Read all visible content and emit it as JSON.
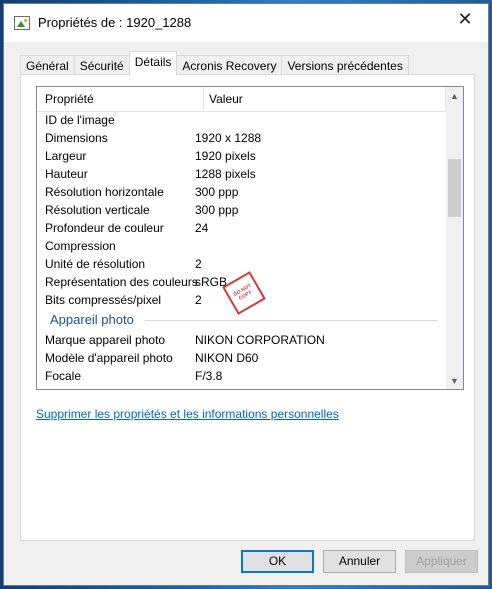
{
  "window": {
    "title": "Propriétés de : 1920_1288",
    "close_glyph": "✕"
  },
  "tabs": [
    {
      "label": "Général"
    },
    {
      "label": "Sécurité"
    },
    {
      "label": "Détails",
      "active": true
    },
    {
      "label": "Acronis Recovery"
    },
    {
      "label": "Versions précédentes"
    }
  ],
  "list": {
    "header_property": "Propriété",
    "header_value": "Valeur",
    "rows": [
      {
        "k": "ID de l'image",
        "v": ""
      },
      {
        "k": "Dimensions",
        "v": "1920 x 1288"
      },
      {
        "k": "Largeur",
        "v": "1920 pixels"
      },
      {
        "k": "Hauteur",
        "v": "1288 pixels"
      },
      {
        "k": "Résolution horizontale",
        "v": "300 ppp"
      },
      {
        "k": "Résolution verticale",
        "v": "300 ppp"
      },
      {
        "k": "Profondeur de couleur",
        "v": "24"
      },
      {
        "k": "Compression",
        "v": ""
      },
      {
        "k": "Unité de résolution",
        "v": "2"
      },
      {
        "k": "Représentation des couleurs",
        "v": "sRGB"
      },
      {
        "k": "Bits compressés/pixel",
        "v": "2"
      }
    ],
    "group_label": "Appareil photo",
    "rows2": [
      {
        "k": "Marque appareil photo",
        "v": "NIKON CORPORATION"
      },
      {
        "k": "Modèle d'appareil photo",
        "v": "NIKON D60"
      },
      {
        "k": "Focale",
        "v": "F/3.8"
      }
    ],
    "scroll_up_glyph": "▲",
    "scroll_down_glyph": "▼"
  },
  "stamp": {
    "line1": "DO NOT",
    "line2": "COPY"
  },
  "link_text": "Supprimer les propriétés et les informations personnelles",
  "buttons": {
    "ok": "OK",
    "cancel": "Annuler",
    "apply": "Appliquer"
  },
  "colors": {
    "accent": "#0078d7",
    "link": "#0066cc",
    "group": "#1e4e9a"
  }
}
